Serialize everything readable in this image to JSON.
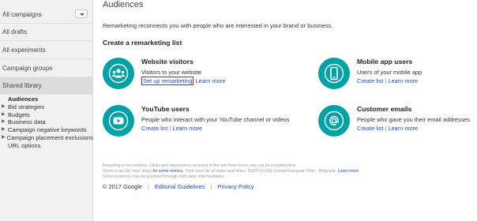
{
  "sidebar": {
    "items": [
      {
        "label": "All campaigns"
      },
      {
        "label": "All drafts"
      },
      {
        "label": "All experiments"
      },
      {
        "label": "Campaign groups"
      },
      {
        "label": "Shared library"
      }
    ],
    "sub_items": [
      {
        "label": "Audiences"
      },
      {
        "label": "Bid strategies"
      },
      {
        "label": "Budgets"
      },
      {
        "label": "Business data"
      },
      {
        "label": "Campaign negative keywords"
      },
      {
        "label": "Campaign placement exclusions"
      },
      {
        "label": "URL options"
      }
    ]
  },
  "main": {
    "title": "Audiences",
    "intro": "Remarketing reconnects you with people who are interested in your brand or business.",
    "section_title": "Create a remarketing list",
    "cards": [
      {
        "title": "Website visitors",
        "desc": "Visitors to your website",
        "link1": "Set up remarketing",
        "link2": "Learn more"
      },
      {
        "title": "Mobile app users",
        "desc": "Users of your mobile app",
        "link1": "Create list",
        "link2": "Learn more"
      },
      {
        "title": "YouTube users",
        "desc": "People who interact with your YouTube channel or videos",
        "link1": "Create list",
        "link2": "Learn more"
      },
      {
        "title": "Customer emails",
        "desc": "People who gave you their email addresses",
        "link1": "Create list",
        "link2": "Learn more"
      }
    ],
    "footnote": {
      "line1": "Reporting is not realtime. Clicks and impressions received in the last three hours may not be included here.",
      "line2_pre": "There is an 18+ hour delay ",
      "line2_link": "for some metrics",
      "line2_post": ". Time zone for all dates and times: (GMT+01:00) Central European Time - Belgrade. ",
      "line2_link2": "Learn more",
      "line3": "Some inventory may be provided through third party intermediaries."
    },
    "footer": {
      "copyright": "© 2017 Google",
      "editorial": "Editorial Guidelines",
      "privacy": "Privacy Policy"
    }
  }
}
